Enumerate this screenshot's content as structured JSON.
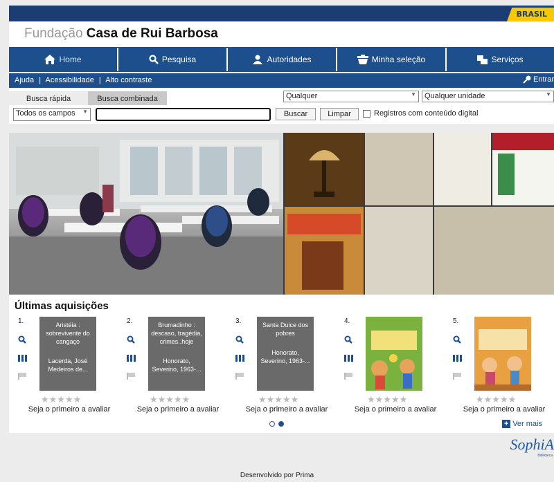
{
  "brand": {
    "gov_badge": "BRASIL"
  },
  "header": {
    "title_light": "Fundação",
    "title_bold": "Casa de Rui Barbosa"
  },
  "nav": {
    "items": [
      {
        "label": "Home",
        "icon": "home-icon"
      },
      {
        "label": "Pesquisa",
        "icon": "search-icon"
      },
      {
        "label": "Autoridades",
        "icon": "users-icon"
      },
      {
        "label": "Minha seleção",
        "icon": "basket-icon"
      },
      {
        "label": "Serviços",
        "icon": "services-icon"
      }
    ]
  },
  "subbar": {
    "link_ajuda": "Ajuda",
    "link_acessibilidade": "Acessibilidade",
    "link_contraste": "Alto contraste",
    "separator": "|",
    "login": "Entrar"
  },
  "search": {
    "tab_rapida": "Busca rápida",
    "tab_combinada": "Busca combinada",
    "select_material": "Qualquer",
    "select_unidade": "Qualquer unidade",
    "select_campos": "Todos os campos",
    "query_value": "",
    "btn_buscar": "Buscar",
    "btn_limpar": "Limpar",
    "digital_label": "Registros com conteúdo digital"
  },
  "acquisitions": {
    "title": "Últimas aquisições",
    "rating_text": "Seja o primeiro a avaliar",
    "stars": "★★★★★",
    "ver_mais": "Ver mais",
    "items": [
      {
        "num": "1.",
        "title": "Aristéia : sobrevivente do cangaço",
        "author": "Lacerda, José Medeiros de..."
      },
      {
        "num": "2.",
        "title": "Brumadinho : descaso, tragédia, crimes..hoje",
        "author": "Honorato, Severino, 1963-..."
      },
      {
        "num": "3.",
        "title": "Santa Duice dos pobres",
        "author": "Honorato, Severino, 1963-..."
      },
      {
        "num": "4.",
        "title": "",
        "author": ""
      },
      {
        "num": "5.",
        "title": "",
        "author": ""
      }
    ],
    "carousel_pages": 2,
    "carousel_active": 2
  },
  "footer": {
    "credit": "Desenvolvido por Prima",
    "logo": "SophiA",
    "logo_sub": "Biblioteca"
  },
  "colors": {
    "navy": "#1c3d74",
    "nav_blue": "#1c4f8c",
    "gov_yellow": "#f6c900"
  }
}
